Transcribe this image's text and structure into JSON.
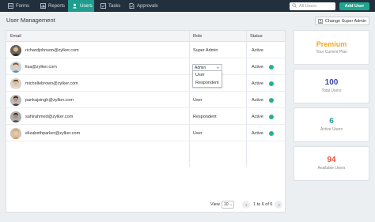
{
  "nav": {
    "tabs": [
      {
        "label": "Forms",
        "icon": "forms-icon"
      },
      {
        "label": "Reports",
        "icon": "reports-icon"
      },
      {
        "label": "Users",
        "icon": "users-icon",
        "active": true
      },
      {
        "label": "Tasks",
        "icon": "tasks-icon"
      },
      {
        "label": "Approvals",
        "icon": "approvals-icon"
      }
    ],
    "search_placeholder": "All Users",
    "add_user_label": "Add User"
  },
  "page": {
    "title": "User Management",
    "change_admin_label": "Change Super Admin"
  },
  "table": {
    "columns": [
      "Email",
      "Role",
      "Status"
    ],
    "rows": [
      {
        "email": "richardjohnson@zylker.com",
        "role": "Super Admin",
        "status": "Active",
        "status_dot": false
      },
      {
        "email": "lisa@zylker.com",
        "role": "Admin",
        "status": "Active",
        "status_dot": true,
        "editing": true
      },
      {
        "email": "michellebrown@zylker.com",
        "role": "",
        "status": "Active",
        "status_dot": true
      },
      {
        "email": "pankajsingh@zylker.com",
        "role": "User",
        "status": "Active",
        "status_dot": true
      },
      {
        "email": "sahirahmed@zylker.com",
        "role": "Respondent",
        "status": "Active",
        "status_dot": true
      },
      {
        "email": "elizabethparker@zylker.com",
        "role": "User",
        "status": "Active",
        "status_dot": true
      }
    ],
    "role_dropdown": {
      "selected": "Admin",
      "options": [
        "User",
        "Respondent"
      ]
    }
  },
  "pagination": {
    "view_label": "View",
    "page_size": "10",
    "range_text": "1 to 6 of 6"
  },
  "cards": [
    {
      "value": "Premium",
      "label": "Your Current Plan",
      "color": "#f5a623"
    },
    {
      "value": "100",
      "label": "Total Users",
      "color": "#3b4aa8"
    },
    {
      "value": "6",
      "label": "Active Users",
      "color": "#2aa39a"
    },
    {
      "value": "94",
      "label": "Available Users",
      "color": "#e8503a"
    }
  ],
  "colors": {
    "topbar": "#22303d",
    "accent": "#1fa68f",
    "active_dot": "#2bae8c"
  }
}
